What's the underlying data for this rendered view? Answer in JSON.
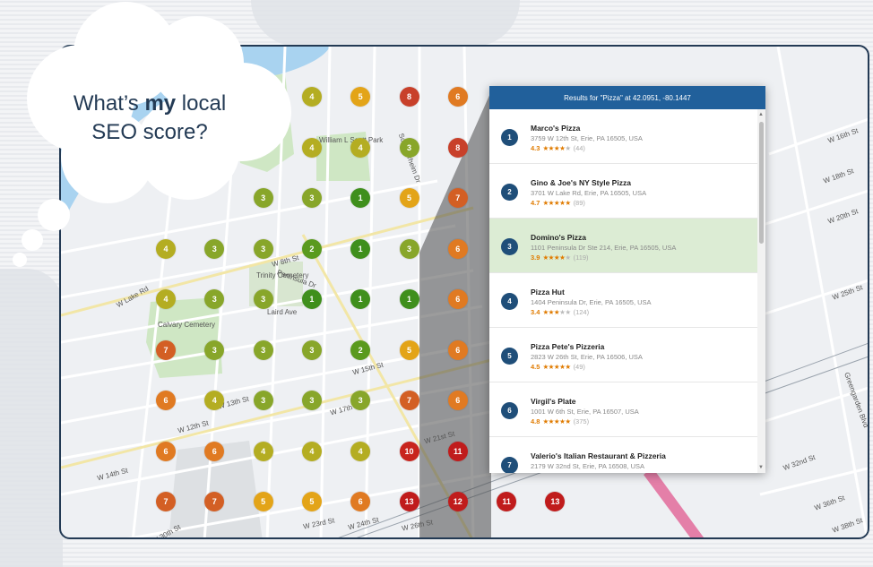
{
  "cloud": {
    "line1_prefix": "What’s ",
    "line1_bold": "my",
    "line1_suffix": " local",
    "line2": "SEO score?"
  },
  "panel": {
    "header": "Results for \"Pizza\" at 42.0951, -80.1447",
    "results": [
      {
        "rank": "1",
        "name": "Marco's Pizza",
        "address": "3759 W 12th St, Erie, PA 16505, USA",
        "rating": "4.3",
        "stars": 4,
        "count": "(44)"
      },
      {
        "rank": "2",
        "name": "Gino & Joe's NY Style Pizza",
        "address": "3701 W Lake Rd, Erie, PA 16505, USA",
        "rating": "4.7",
        "stars": 5,
        "count": "(89)"
      },
      {
        "rank": "3",
        "name": "Domino's Pizza",
        "address": "1101 Peninsula Dr Ste 214, Erie, PA 16505, USA",
        "rating": "3.9",
        "stars": 4,
        "count": "(119)",
        "highlight": true
      },
      {
        "rank": "4",
        "name": "Pizza Hut",
        "address": "1404 Peninsula Dr, Erie, PA 16505, USA",
        "rating": "3.4",
        "stars": 3,
        "count": "(124)"
      },
      {
        "rank": "5",
        "name": "Pizza Pete's Pizzeria",
        "address": "2823 W 26th St, Erie, PA 16506, USA",
        "rating": "4.5",
        "stars": 5,
        "count": "(49)"
      },
      {
        "rank": "6",
        "name": "Virgil's Plate",
        "address": "1001 W 6th St, Erie, PA 16507, USA",
        "rating": "4.8",
        "stars": 5,
        "count": "(375)"
      },
      {
        "rank": "7",
        "name": "Valerio's Italian Restaurant & Pizzeria",
        "address": "2179 W 32nd St, Erie, PA 16508, USA",
        "rating": "",
        "stars": 0,
        "count": ""
      }
    ]
  },
  "grid": {
    "colors": {
      "1": "#3f8f1c",
      "2": "#5a9a1e",
      "3": "#88a62a",
      "4": "#b4ad22",
      "5": "#e3a418",
      "6": "#e07a22",
      "7": "#d35f24",
      "8": "#c8402a",
      "10": "#c8241d",
      "11": "#c01c1c",
      "12": "#c01c1c",
      "13": "#c01c1c"
    },
    "rows": [
      [
        "",
        "",
        "",
        "4",
        "5",
        "8",
        "6",
        "",
        "",
        ""
      ],
      [
        "",
        "",
        "",
        "4",
        "4",
        "3",
        "8",
        "",
        "",
        ""
      ],
      [
        "",
        "",
        "3",
        "3",
        "1",
        "5",
        "7",
        "",
        "",
        ""
      ],
      [
        "4",
        "3",
        "3",
        "2",
        "1",
        "3",
        "6",
        "",
        "",
        ""
      ],
      [
        "4",
        "3",
        "3",
        "1",
        "1",
        "1",
        "6",
        "",
        "",
        ""
      ],
      [
        "7",
        "3",
        "3",
        "3",
        "2",
        "5",
        "6",
        "",
        "",
        ""
      ],
      [
        "6",
        "4",
        "3",
        "3",
        "3",
        "7",
        "6",
        "",
        "",
        ""
      ],
      [
        "6",
        "6",
        "4",
        "4",
        "4",
        "10",
        "11",
        "",
        "",
        ""
      ],
      [
        "7",
        "7",
        "5",
        "5",
        "6",
        "13",
        "12",
        "11",
        "13",
        ""
      ]
    ]
  },
  "map_labels": [
    {
      "text": "W 8th St",
      "id": "w8th"
    },
    {
      "text": "W Lake Rd",
      "id": "wlake"
    },
    {
      "text": "Peninsula Dr",
      "id": "pen"
    },
    {
      "text": "W 12th St",
      "id": "w12"
    },
    {
      "text": "W 26th St",
      "id": "w26"
    },
    {
      "text": "W 32nd St",
      "id": "w32"
    },
    {
      "text": "W 20th St",
      "id": "w20"
    },
    {
      "text": "W 18th St",
      "id": "w18"
    },
    {
      "text": "W 16th St",
      "id": "w16"
    },
    {
      "text": "W 38th St",
      "id": "w38"
    },
    {
      "text": "W 36th St",
      "id": "w36"
    },
    {
      "text": "W 25th St",
      "id": "w25"
    },
    {
      "text": "W 13th St",
      "id": "w13"
    },
    {
      "text": "W 17th St",
      "id": "w17"
    },
    {
      "text": "W 21st St",
      "id": "w21"
    },
    {
      "text": "W 23rd St",
      "id": "w23"
    },
    {
      "text": "W 24th St",
      "id": "w24"
    },
    {
      "text": "W 14th St",
      "id": "w14"
    },
    {
      "text": "Laird Ave",
      "id": "laird"
    },
    {
      "text": "Calvary Cemetery",
      "id": "calv"
    },
    {
      "text": "Trinity Cemetery",
      "id": "trin"
    },
    {
      "text": "William L Scott Park",
      "id": "scott"
    },
    {
      "text": "W 30th St",
      "id": "w30"
    },
    {
      "text": "W 15th St",
      "id": "w15"
    },
    {
      "text": "Sommerheim Dr",
      "id": "som"
    },
    {
      "text": "Greengarden Blvd",
      "id": "green"
    }
  ]
}
